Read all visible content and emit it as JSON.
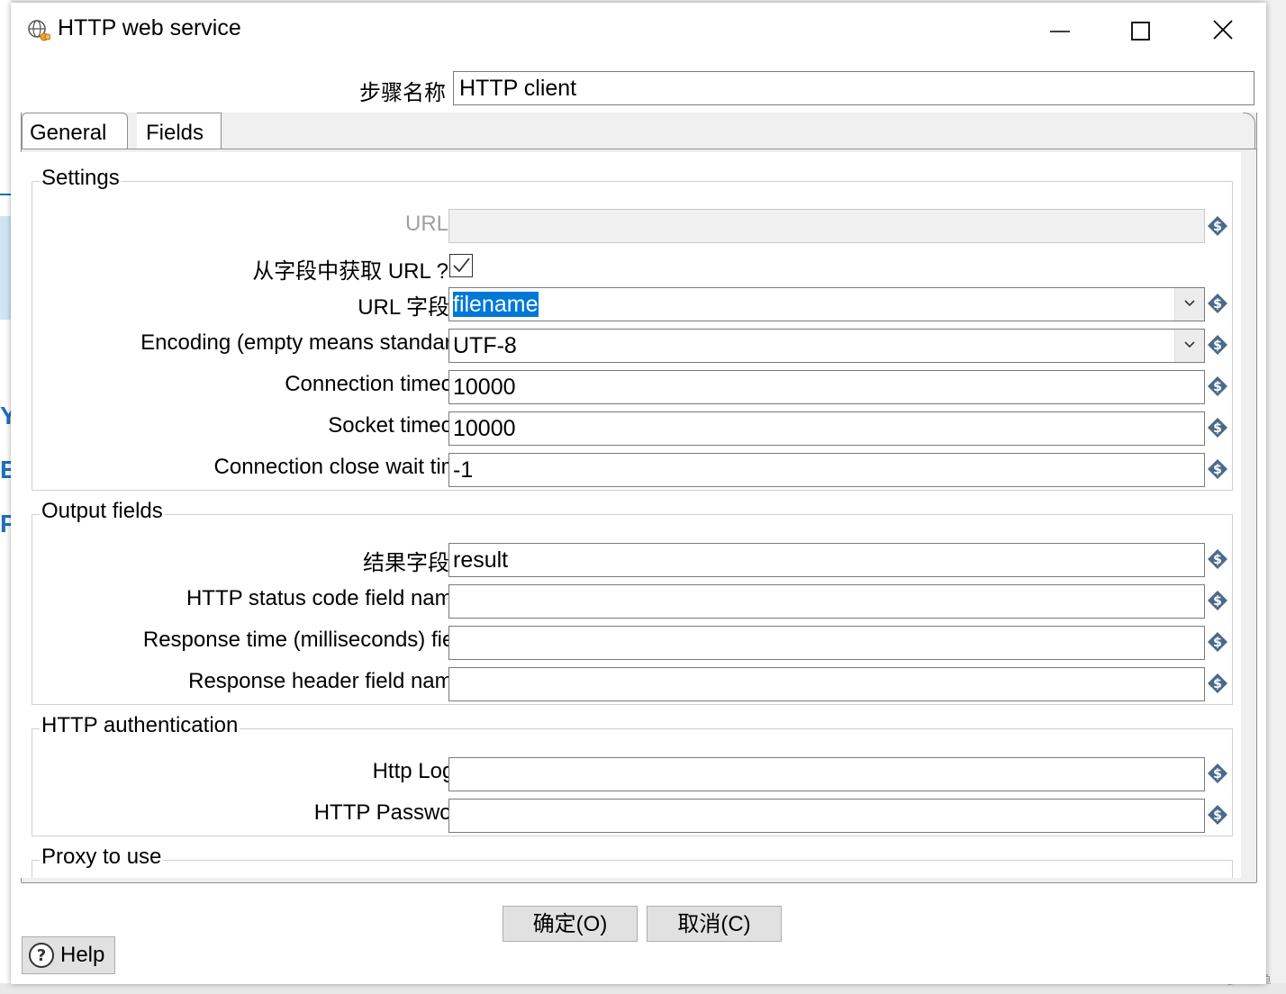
{
  "window": {
    "title": "HTTP web service"
  },
  "step_name": {
    "label": "步骤名称",
    "value": "HTTP client"
  },
  "tabs": [
    {
      "label": "General",
      "active": true
    },
    {
      "label": "Fields",
      "active": false
    }
  ],
  "settings": {
    "title": "Settings",
    "url": {
      "label": "URL",
      "value": "",
      "disabled": true
    },
    "url_from_field": {
      "label": "从字段中获取 URL ?",
      "checked": true
    },
    "url_field_name": {
      "label": "URL 字段名",
      "value": "filename"
    },
    "encoding": {
      "label": "Encoding (empty means standard)",
      "value": "UTF-8"
    },
    "connection_timeout": {
      "label": "Connection timeout",
      "value": "10000"
    },
    "socket_timeout": {
      "label": "Socket timeout",
      "value": "10000"
    },
    "connection_close_wait_time": {
      "label": "Connection close wait time",
      "value": "-1"
    }
  },
  "output_fields": {
    "title": "Output fields",
    "result_field_name": {
      "label": "结果字段名",
      "value": "result"
    },
    "http_status_code_field": {
      "label": "HTTP status code field name",
      "value": ""
    },
    "response_time_field": {
      "label": "Response time (milliseconds) field",
      "value": ""
    },
    "response_header_field": {
      "label": "Response header field name",
      "value": ""
    }
  },
  "http_authentication": {
    "title": "HTTP authentication",
    "http_login": {
      "label": "Http Login",
      "value": ""
    },
    "http_password": {
      "label": "HTTP Password",
      "value": ""
    }
  },
  "proxy": {
    "title": "Proxy to use"
  },
  "buttons": {
    "ok": "确定(O)",
    "cancel": "取消(C)",
    "help": "Help"
  },
  "watermark": "CSDN @乌糯鱼",
  "colors": {
    "selection": "#0078d7",
    "variable_icon": "#4a6a8a"
  }
}
